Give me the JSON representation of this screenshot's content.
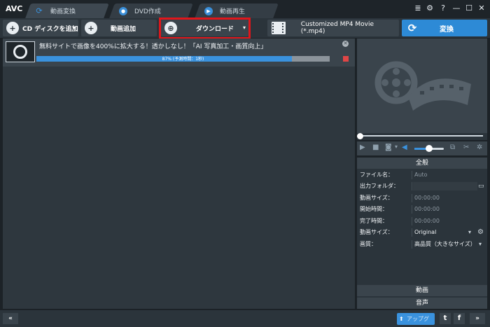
{
  "app": {
    "logo": "AVC"
  },
  "tabs": [
    {
      "label": "動画変換",
      "icon": "refresh-icon"
    },
    {
      "label": "DVD作成",
      "icon": "disc-icon"
    },
    {
      "label": "動画再生",
      "icon": "play-icon"
    }
  ],
  "window_controls": {
    "menu": "≣",
    "settings": "⚙",
    "help": "?",
    "minimize": "—",
    "maximize": "☐",
    "close": "✕"
  },
  "toolbar": {
    "add_cd_label": "CD ディスクを追加",
    "add_video_label": "動画追加",
    "download_label": "ダウンロード",
    "format_label": "Customized MP4 Movie (*.mp4)",
    "convert_label": "変換"
  },
  "task": {
    "title": "無料サイトで画像を400%に拡大する！透かしなし！「AI 写真加工・画質向上」",
    "progress_text": "87% (予測時間：1秒)",
    "progress": 0.87
  },
  "properties": {
    "header": "全般",
    "rows": [
      {
        "key": "ファイル名：",
        "value": "Auto"
      },
      {
        "key": "出力フォルダ：",
        "value": ""
      },
      {
        "key": "動画サイズ：",
        "value": "00:00:00"
      },
      {
        "key": "開始時間：",
        "value": "00:00:00"
      },
      {
        "key": "完了時間：",
        "value": "00:00:00"
      },
      {
        "key": "動画サイズ：",
        "value": "Original"
      },
      {
        "key": "画質：",
        "value": "高品質（大きなサイズ）"
      }
    ],
    "section_video": "動画",
    "section_audio": "音声"
  },
  "player": {
    "volume": 0.6
  },
  "footer": {
    "upgrade_label": "アップグレ..."
  }
}
